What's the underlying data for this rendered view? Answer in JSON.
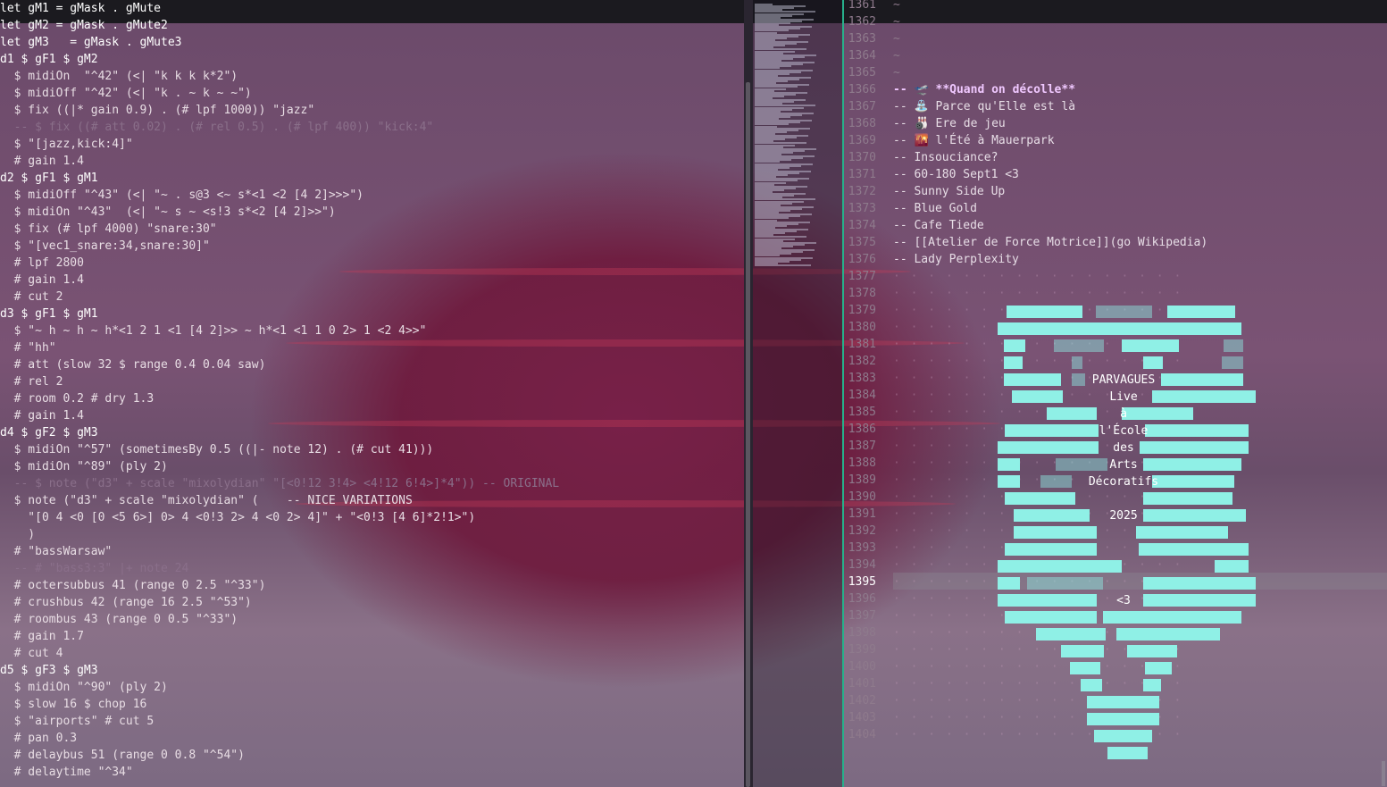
{
  "left_code": [
    "let gM1 = gMask . gMute",
    "let gM2 = gMask . gMute2",
    "let gM3   = gMask . gMute3",
    "d1 $ gF1 $ gM2",
    "  $ midiOn  \"^42\" (<| \"k k k k*2\")",
    "  $ midiOff \"^42\" (<| \"k . ~ k ~ ~\")",
    "  $ fix ((|* gain 0.9) . (# lpf 1000)) \"jazz\"",
    "  -- $ fix ((# att 0.02) . (# rel 0.5) . (# lpf 400)) \"kick:4\"",
    "  $ \"[jazz,kick:4]\"",
    "  # gain 1.4",
    "d2 $ gF1 $ gM1",
    "  $ midiOff \"^43\" (<| \"~ . s@3 <~ s*<1 <2 [4 2]>>>\")",
    "  $ midiOn \"^43\"  (<| \"~ s ~ <s!3 s*<2 [4 2]>>\")",
    "  $ fix (# lpf 4000) \"snare:30\"",
    "  $ \"[vec1_snare:34,snare:30]\"",
    "  # lpf 2800",
    "  # gain 1.4",
    "  # cut 2",
    "d3 $ gF1 $ gM1",
    "  $ \"~ h ~ h ~ h*<1 2 1 <1 [4 2]>> ~ h*<1 <1 1 0 2> 1 <2 4>>\"",
    "  # \"hh\"",
    "  # att (slow 32 $ range 0.4 0.04 saw)",
    "  # rel 2",
    "  # room 0.2 # dry 1.3",
    "  # gain 1.4",
    "d4 $ gF2 $ gM3",
    "  $ midiOn \"^57\" (sometimesBy 0.5 ((|- note 12) . (# cut 41)))",
    "  $ midiOn \"^89\" (ply 2)",
    "  -- $ note (\"d3\" + scale \"mixolydian\" \"[<0!12 3!4> <4!12 6!4>]*4\")) -- ORIGINAL",
    "  $ note (\"d3\" + scale \"mixolydian\" (    -- NICE VARIATIONS",
    "    \"[0 4 <0 [0 <5 6>] 0> 4 <0!3 2> 4 <0 2> 4]\" + \"<0!3 [4 6]*2!1>\")",
    "    )",
    "  # \"bassWarsaw\"",
    "  -- # \"bass3:3\" |+ note 24",
    "  # octersubbus 41 (range 0 2.5 \"^33\")",
    "  # crushbus 42 (range 16 2.5 \"^53\")",
    "  # roombus 43 (range 0 0.5 \"^33\")",
    "  # gain 1.7",
    "  # cut 4",
    "d5 $ gF3 $ gM3",
    "  $ midiOn \"^90\" (ply 2)",
    "  $ slow 16 $ chop 16",
    "  $ \"airports\" # cut 5",
    "  # pan 0.3",
    "  # delaybus 51 (range 0 0.8 \"^54\")",
    "  # delaytime \"^34\""
  ],
  "line_numbers": [
    "1361",
    "1362",
    "1363",
    "1364",
    "1365",
    "1366",
    "1367",
    "1368",
    "1369",
    "1370",
    "1371",
    "1372",
    "1373",
    "1374",
    "1375",
    "1376",
    "1377",
    "1378",
    "1379",
    "1380",
    "1381",
    "1382",
    "1383",
    "1384",
    "1385",
    "1386",
    "1387",
    "1388",
    "1389",
    "1390",
    "1391",
    "1392",
    "1393",
    "1394",
    "1395",
    "1396",
    "1397",
    "1398",
    "1399",
    "1400",
    "1401",
    "1402",
    "1403",
    "1404"
  ],
  "active_line": "1395",
  "right_lines": [
    {
      "text": "~",
      "bold": false
    },
    {
      "text": "~",
      "bold": false
    },
    {
      "text": "~",
      "bold": false
    },
    {
      "text": "~",
      "bold": false
    },
    {
      "text": "~",
      "bold": false
    },
    {
      "text": "-- 🛫 **Quand on décolle**",
      "bold": true
    },
    {
      "text": "-- ⛲ Parce qu'Elle est là",
      "bold": false
    },
    {
      "text": "-- 🎳 Ere de jeu",
      "bold": false
    },
    {
      "text": "-- 🌇 l'Été à Mauerpark",
      "bold": false
    },
    {
      "text": "-- Insouciance?",
      "bold": false
    },
    {
      "text": "-- 60-180 Sept1 <3",
      "bold": false
    },
    {
      "text": "-- Sunny Side Up",
      "bold": false
    },
    {
      "text": "-- Blue Gold",
      "bold": false
    },
    {
      "text": "-- Cafe Tiede",
      "bold": false
    },
    {
      "text": "-- [[Atelier de Force Motrice]](go Wikipedia)",
      "bold": false
    },
    {
      "text": "-- Lady Perplexity",
      "bold": false
    }
  ],
  "heart_text": [
    "PARVAGUES",
    "Live",
    "à",
    "l'École",
    "des",
    "Arts",
    "Décoratifs",
    "2025",
    "<3"
  ],
  "colors": {
    "accent": "#27b08a",
    "heart": "#8ff0e6",
    "topbar": "#1b1a1f"
  }
}
